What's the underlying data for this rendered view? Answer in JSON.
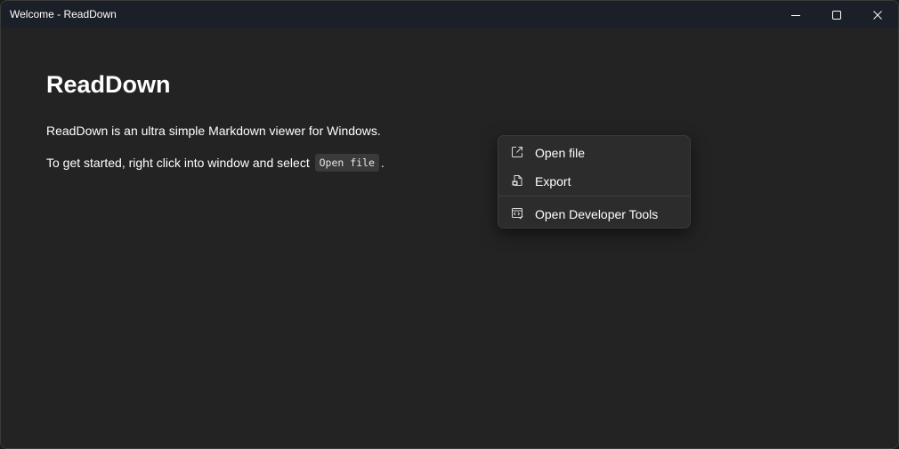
{
  "window": {
    "title": "Welcome - ReadDown"
  },
  "titlebar": {
    "controls": [
      {
        "icon": "minimize-icon"
      },
      {
        "icon": "maximize-icon"
      },
      {
        "icon": "close-icon"
      }
    ]
  },
  "content": {
    "heading": "ReadDown",
    "para1": "ReadDown is an ultra simple Markdown viewer for Windows.",
    "para2_prefix": "To get started, right click into window and select ",
    "para2_code": "Open file",
    "para2_suffix": "."
  },
  "context_menu": {
    "items": [
      {
        "label": "Open file",
        "icon": "open-external-icon"
      },
      {
        "label": "Export",
        "icon": "export-file-icon"
      },
      {
        "label": "Open Developer Tools",
        "icon": "developer-tools-icon"
      }
    ]
  },
  "colors": {
    "titlebar_bg": "#1b1f27",
    "content_bg": "#232323",
    "menu_bg": "#2c2c2c",
    "text": "#ffffff",
    "code_bg": "#3a3a3a"
  }
}
